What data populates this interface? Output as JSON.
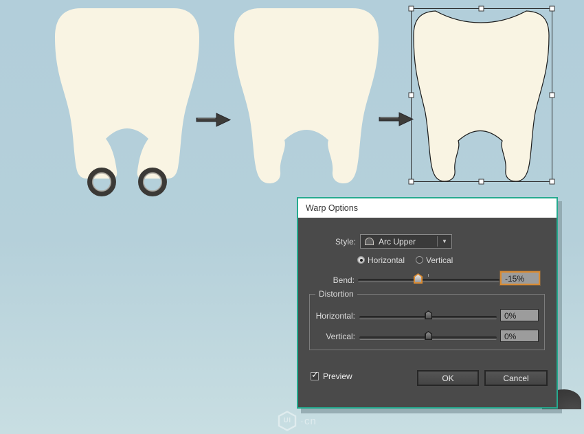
{
  "colors": {
    "background_top": "#b2ceda",
    "background_bottom": "#c8dee2",
    "tooth_fill": "#f9f4e3",
    "outline": "#1c1c1c",
    "arrow": "#3d3c39",
    "ring": "#3b3936",
    "dialog_accent": "#25aa8f",
    "dialog_body": "#4a4a4a",
    "focus_orange": "#d98b33"
  },
  "icons": {
    "checkmark": "✓",
    "dropdown_arrow": "▼"
  },
  "dialog": {
    "title": "Warp Options",
    "style": {
      "label": "Style:",
      "value": "Arc Upper"
    },
    "orientation": {
      "horizontal": "Horizontal",
      "vertical": "Vertical",
      "selected": "Horizontal"
    },
    "bend": {
      "label": "Bend:",
      "value": "-15%"
    },
    "distortion": {
      "label": "Distortion",
      "horizontal": {
        "label": "Horizontal:",
        "value": "0%"
      },
      "vertical": {
        "label": "Vertical:",
        "value": "0%"
      }
    },
    "preview": {
      "label": "Preview",
      "checked": true
    },
    "buttons": {
      "ok": "OK",
      "cancel": "Cancel"
    }
  },
  "watermark": {
    "logo": "UI",
    "suffix": "·cn"
  }
}
